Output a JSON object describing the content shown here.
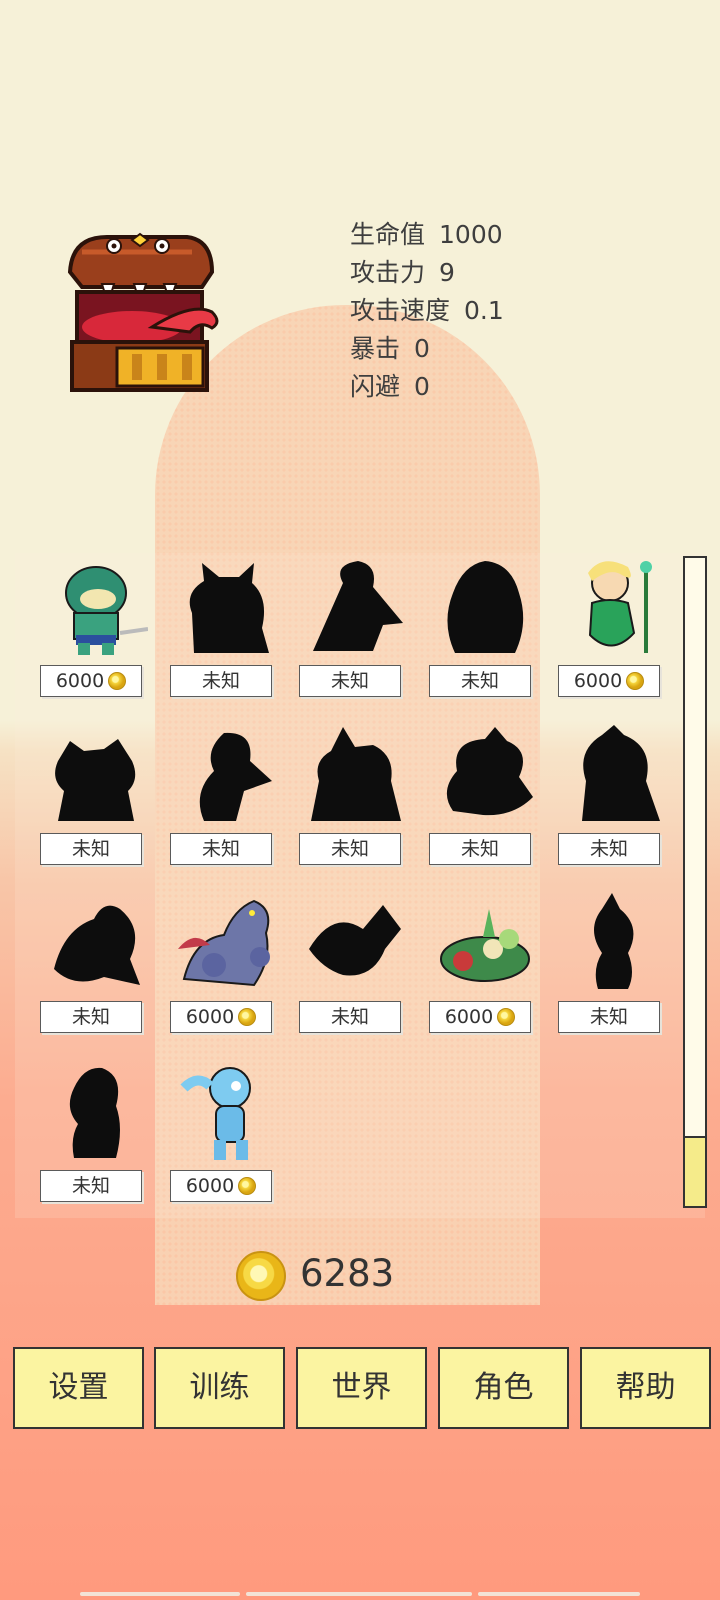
{
  "stats": [
    {
      "label": "生命值",
      "value": "1000"
    },
    {
      "label": "攻击力",
      "value": "9"
    },
    {
      "label": "攻击速度",
      "value": "0.1"
    },
    {
      "label": "暴击",
      "value": "0"
    },
    {
      "label": "闪避",
      "value": "0"
    }
  ],
  "characters": [
    {
      "label": "6000",
      "unlocked": true,
      "has_coin": true,
      "icon": "fish-warrior-icon"
    },
    {
      "label": "未知",
      "unlocked": false,
      "has_coin": false,
      "icon": "silhouette-icon"
    },
    {
      "label": "未知",
      "unlocked": false,
      "has_coin": false,
      "icon": "silhouette-icon"
    },
    {
      "label": "未知",
      "unlocked": false,
      "has_coin": false,
      "icon": "silhouette-icon"
    },
    {
      "label": "6000",
      "unlocked": true,
      "has_coin": true,
      "icon": "mermaid-icon"
    },
    {
      "label": "未知",
      "unlocked": false,
      "has_coin": false,
      "icon": "silhouette-icon"
    },
    {
      "label": "未知",
      "unlocked": false,
      "has_coin": false,
      "icon": "silhouette-icon"
    },
    {
      "label": "未知",
      "unlocked": false,
      "has_coin": false,
      "icon": "silhouette-icon"
    },
    {
      "label": "未知",
      "unlocked": false,
      "has_coin": false,
      "icon": "silhouette-icon"
    },
    {
      "label": "未知",
      "unlocked": false,
      "has_coin": false,
      "icon": "silhouette-icon"
    },
    {
      "label": "未知",
      "unlocked": false,
      "has_coin": false,
      "icon": "silhouette-icon"
    },
    {
      "label": "6000",
      "unlocked": true,
      "has_coin": true,
      "icon": "three-headed-dragon-icon"
    },
    {
      "label": "未知",
      "unlocked": false,
      "has_coin": false,
      "icon": "silhouette-icon"
    },
    {
      "label": "6000",
      "unlocked": true,
      "has_coin": true,
      "icon": "plant-frog-icon"
    },
    {
      "label": "未知",
      "unlocked": false,
      "has_coin": false,
      "icon": "silhouette-icon"
    },
    {
      "label": "未知",
      "unlocked": false,
      "has_coin": false,
      "icon": "silhouette-icon"
    },
    {
      "label": "6000",
      "unlocked": true,
      "has_coin": true,
      "icon": "water-spirit-icon"
    }
  ],
  "coins": {
    "amount": "6283"
  },
  "buttons": {
    "settings": "设置",
    "training": "训练",
    "world": "世界",
    "character": "角色",
    "help": "帮助"
  },
  "colors": {
    "button_bg": "#fbf4a1",
    "accent_coin": "#f5d43c"
  }
}
